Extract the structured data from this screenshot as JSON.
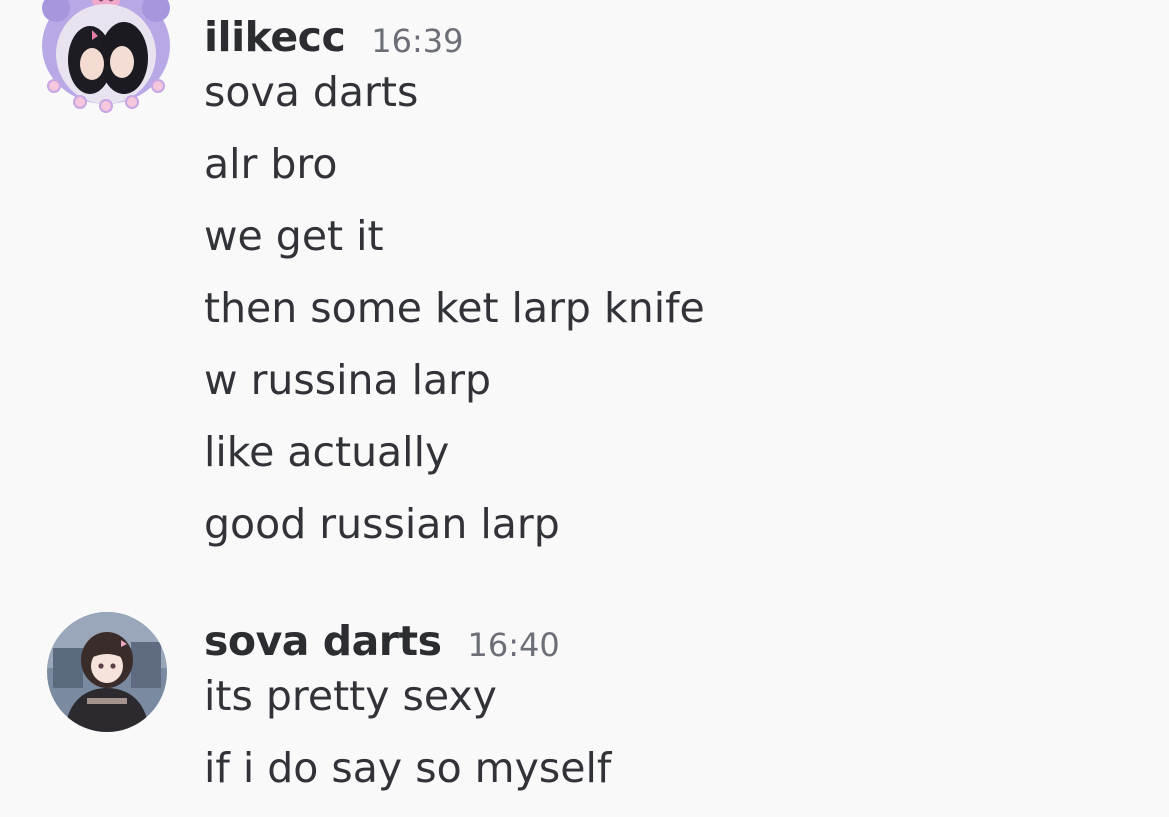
{
  "colors": {
    "background": "#f9f9fa",
    "username": "#2b2d31",
    "timestamp": "#6d6f78",
    "message_text": "#313338",
    "kuromi_frame": "#b8a9e6"
  },
  "messages": [
    {
      "username": "ilikecc",
      "timestamp": "16:39",
      "avatar_icon": "kuromi-frame-avatar-icon",
      "lines": [
        "sova darts",
        "alr bro",
        "we get it",
        "then some ket larp knife",
        "w russina larp",
        "like actually",
        "good russian larp"
      ]
    },
    {
      "username": "sova darts",
      "timestamp": "16:40",
      "avatar_icon": "anime-girl-avatar-icon",
      "lines": [
        "its pretty sexy",
        "if i do say so myself"
      ]
    }
  ]
}
